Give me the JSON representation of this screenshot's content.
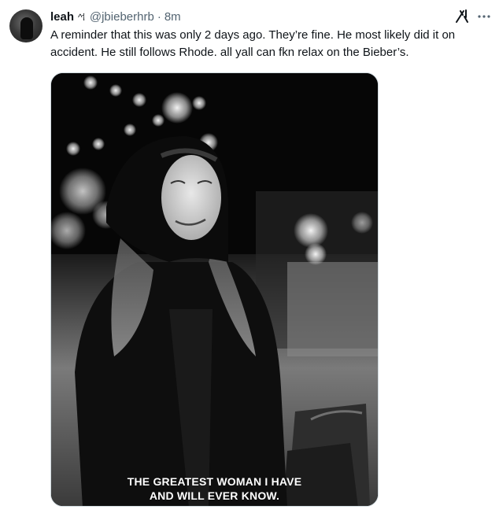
{
  "tweet": {
    "author_name": "leah",
    "author_emoji": "^⸶",
    "handle": "@jbieberhrb",
    "separator": "·",
    "time": "8m",
    "text": "A reminder that this was only 2 days ago. They’re fine. He most likely did it on accident. He still follows Rhode. all yall can fkn relax on the Bieber’s.",
    "avatar_alt": "profile photo",
    "icons": {
      "grok": "grok-icon",
      "more": "more-icon"
    },
    "media": {
      "caption_line1": "THE GREATEST WOMAN I HAVE",
      "caption_line2": "AND WILL EVER KNOW.",
      "style": "black-and-white photo"
    }
  },
  "colors": {
    "text_primary": "#0f1419",
    "text_secondary": "#536471",
    "border": "#cfd9de",
    "background": "#ffffff"
  }
}
